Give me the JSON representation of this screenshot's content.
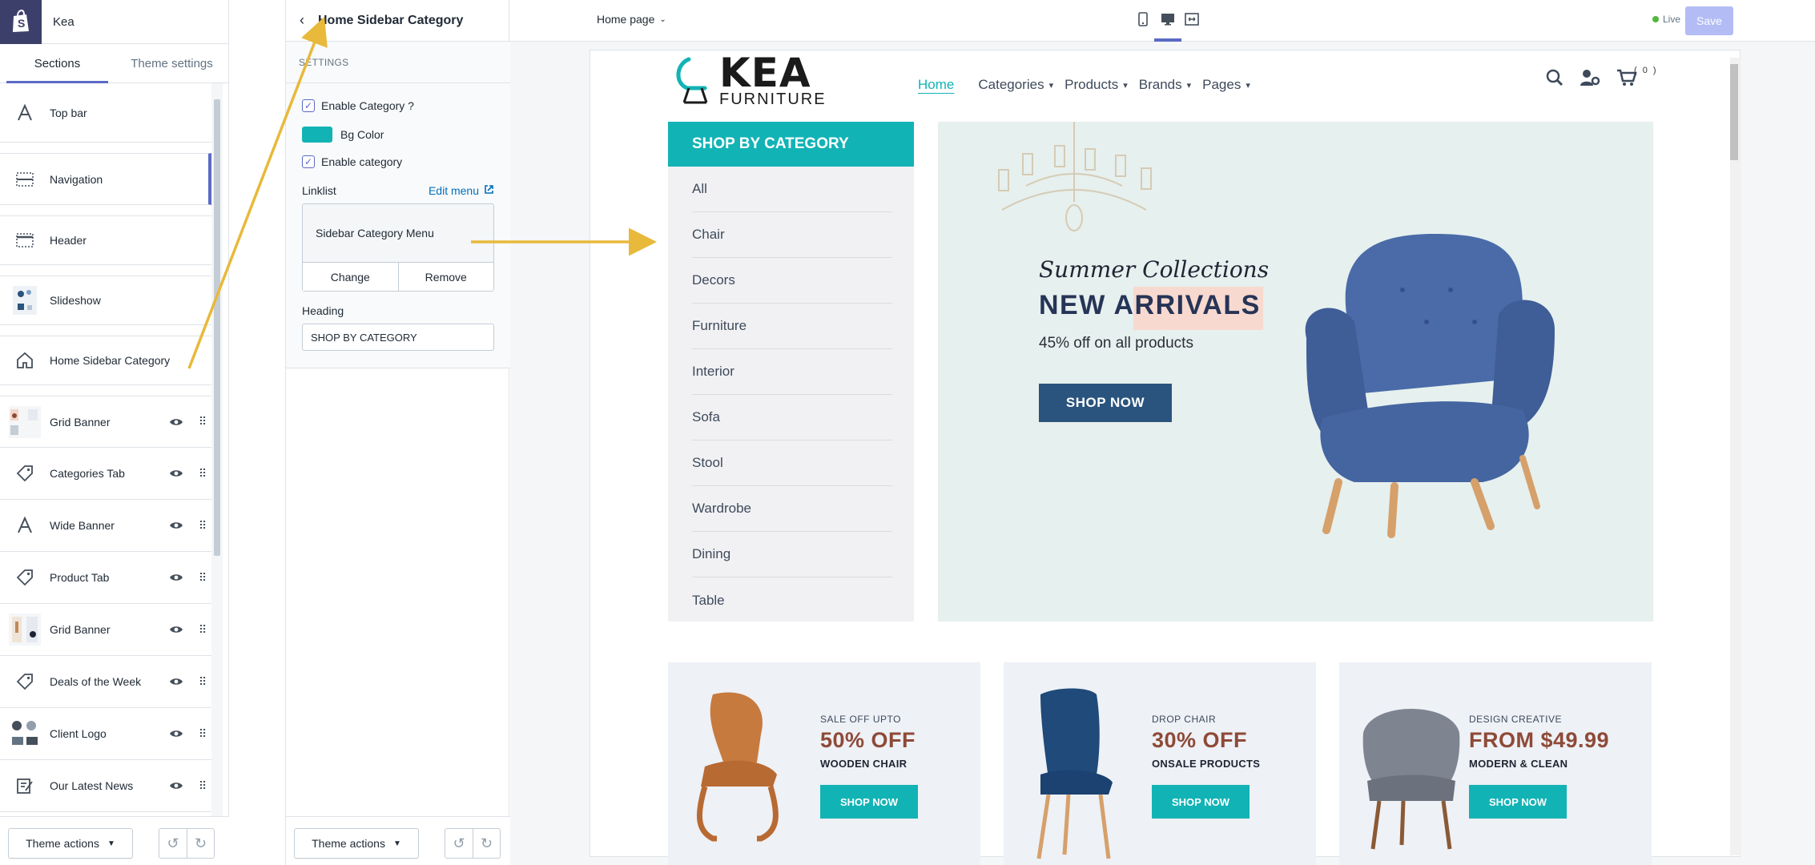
{
  "store": {
    "name": "Kea"
  },
  "left_tabs": [
    {
      "label": "Sections"
    },
    {
      "label": "Theme settings"
    }
  ],
  "sections": [
    {
      "label": "Top bar",
      "icon": "text-icon"
    },
    {
      "label": "Navigation",
      "icon": "navigation-icon"
    },
    {
      "label": "Header",
      "icon": "header-icon"
    },
    {
      "label": "Slideshow",
      "icon": "slideshow-thumbnail"
    },
    {
      "label": "Home Sidebar Category",
      "icon": "home-icon"
    },
    {
      "label": "Grid Banner",
      "icon": "grid-banner-thumbnail"
    },
    {
      "label": "Categories Tab",
      "icon": "tag-icon"
    },
    {
      "label": "Wide Banner",
      "icon": "text-icon"
    },
    {
      "label": "Product Tab",
      "icon": "tag-icon"
    },
    {
      "label": "Grid Banner",
      "icon": "grid-banner-thumbnail"
    },
    {
      "label": "Deals of the Week",
      "icon": "tag-icon"
    },
    {
      "label": "Client Logo",
      "icon": "client-logo-thumbnail"
    },
    {
      "label": "Our Latest News",
      "icon": "blog-icon"
    }
  ],
  "footer": {
    "theme_actions": "Theme actions"
  },
  "settings": {
    "title": "Home Sidebar Category",
    "section_label": "SETTINGS",
    "enable_category_q": "Enable Category ?",
    "bg_color_label": "Bg Color",
    "bg_color": "#12b3b5",
    "enable_category": "Enable category",
    "linklist_label": "Linklist",
    "edit_menu": "Edit menu",
    "menu_name": "Sidebar Category Menu",
    "change": "Change",
    "remove": "Remove",
    "heading_label": "Heading",
    "heading_value": "SHOP BY CATEGORY"
  },
  "topbar": {
    "page": "Home page",
    "live": "Live",
    "save": "Save"
  },
  "storefront": {
    "logo_main": "KEA",
    "logo_sub": "FURNITURE",
    "nav": [
      "Home",
      "Categories",
      "Products",
      "Brands",
      "Pages"
    ],
    "cart_count": "( 0 )",
    "sidebar_heading": "SHOP BY CATEGORY",
    "categories": [
      "All",
      "Chair",
      "Decors",
      "Furniture",
      "Interior",
      "Sofa",
      "Stool",
      "Wardrobe",
      "Dining",
      "Table"
    ],
    "slide": {
      "script": "Summer Collections",
      "title": "NEW ARRIVALS",
      "desc": "45% off on all products",
      "button": "SHOP NOW"
    },
    "banners": [
      {
        "pre": "SALE OFF UPTO",
        "big": "50% OFF",
        "sub": "WOODEN CHAIR",
        "button": "SHOP NOW"
      },
      {
        "pre": "DROP CHAIR",
        "big": "30% OFF",
        "sub": "ONSALE PRODUCTS",
        "button": "SHOP NOW"
      },
      {
        "pre": "DESIGN CREATIVE",
        "big": "FROM $49.99",
        "sub": "MODERN & CLEAN",
        "button": "SHOP NOW"
      }
    ]
  },
  "colors": {
    "accent": "#12b3b5",
    "shopify_purple": "#5c6ac4",
    "annotation_arrow": "#e8b93a",
    "slide_button": "#2a547e"
  }
}
